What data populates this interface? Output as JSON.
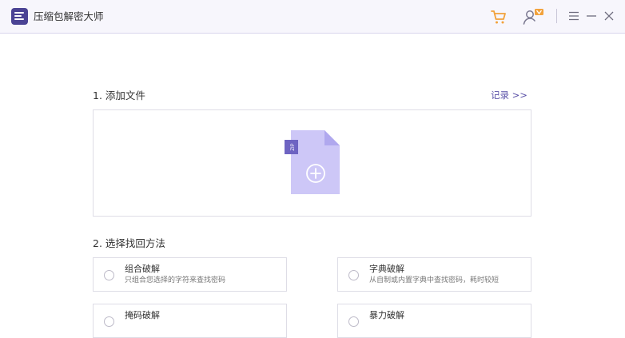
{
  "app": {
    "title": "压缩包解密大师"
  },
  "icons": {
    "logo": "archive-logo-icon",
    "cart": "cart-icon",
    "user": "user-vip-icon",
    "menu": "menu-icon",
    "minimize": "minimize-icon",
    "close": "close-icon",
    "file": "zip-file-add-icon"
  },
  "colors": {
    "accent": "#5b52a8",
    "logo": "#4b4394",
    "cart": "#f2a23b",
    "file": "#cdc7f7"
  },
  "step1": {
    "label": "1. 添加文件",
    "record_link": "记录 >>",
    "file_badge": "ZIP"
  },
  "step2": {
    "label": "2. 选择找回方法"
  },
  "methods": [
    {
      "title": "组合破解",
      "desc": "只组合您选择的字符来查找密码"
    },
    {
      "title": "字典破解",
      "desc": "从自制或内置字典中查找密码，耗时较短"
    },
    {
      "title": "掩码破解",
      "desc": ""
    },
    {
      "title": "暴力破解",
      "desc": ""
    }
  ]
}
